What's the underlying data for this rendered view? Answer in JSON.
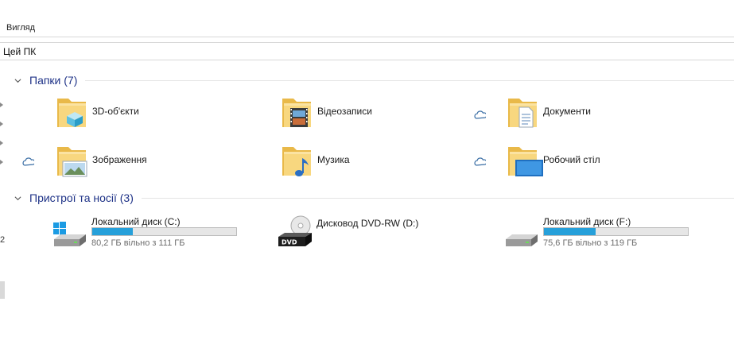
{
  "ribbon": {
    "tab_view": "Вигляд"
  },
  "address": {
    "path": "Цей ПК"
  },
  "nav_pane": {
    "partial_text": "2"
  },
  "groups": {
    "folders": {
      "title": "Папки (7)"
    },
    "devices": {
      "title": "Пристрої та носії (3)"
    }
  },
  "folders": [
    {
      "label": "3D-об'єкти",
      "icon": "3d-objects-folder-icon",
      "cloud": false
    },
    {
      "label": "Відеозаписи",
      "icon": "videos-folder-icon",
      "cloud": false
    },
    {
      "label": "Документи",
      "icon": "documents-folder-icon",
      "cloud": true
    },
    {
      "label": "Зображення",
      "icon": "pictures-folder-icon",
      "cloud": true
    },
    {
      "label": "Музика",
      "icon": "music-folder-icon",
      "cloud": false
    },
    {
      "label": "Робочий стіл",
      "icon": "desktop-folder-icon",
      "cloud": true
    }
  ],
  "drives": [
    {
      "name": "Локальний диск (C:)",
      "free": "80,2 ГБ вільно з 111 ГБ",
      "used_fraction": 0.28,
      "icon": "windows-drive-icon"
    },
    {
      "name": "Дисковод DVD-RW (D:)",
      "free": "",
      "used_fraction": null,
      "icon": "dvd-drive-icon"
    },
    {
      "name": "Локальний диск (F:)",
      "free": "75,6 ГБ вільно з 119 ГБ",
      "used_fraction": 0.36,
      "icon": "hard-drive-icon"
    }
  ],
  "colors": {
    "accent": "#26a0da",
    "group_title": "#1e3287",
    "folder": "#f6d27a"
  }
}
